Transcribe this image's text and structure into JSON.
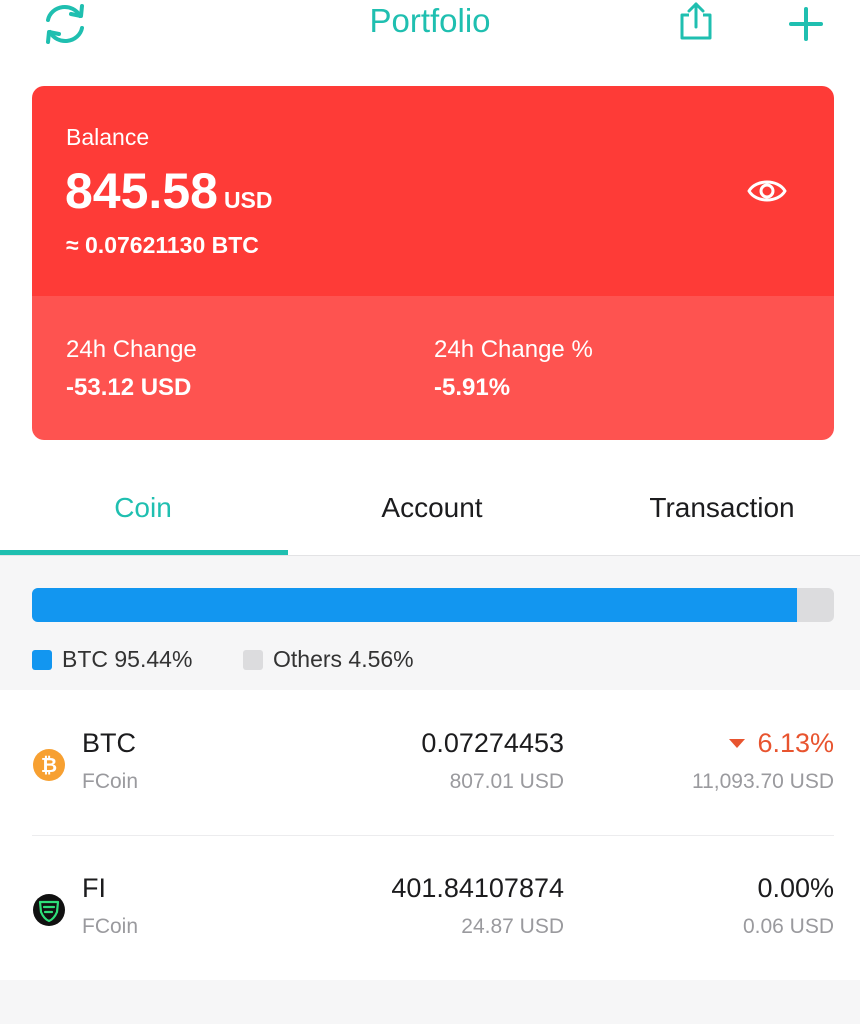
{
  "header": {
    "title": "Portfolio",
    "left_icon": "refresh-icon",
    "right_icons": [
      "share-icon",
      "plus-icon"
    ]
  },
  "balance": {
    "label": "Balance",
    "amount": "845.58",
    "unit": "USD",
    "btc_equivalent": "≈ 0.07621130 BTC",
    "visibility_icon": "eye-icon",
    "change_label": "24h Change",
    "change_value": "-53.12 USD",
    "change_pct_label": "24h Change %",
    "change_pct_value": "-5.91%"
  },
  "tabs": [
    {
      "label": "Coin",
      "active": true
    },
    {
      "label": "Account",
      "active": false
    },
    {
      "label": "Transaction",
      "active": false
    }
  ],
  "allocation": {
    "btc_fraction": 0.9544,
    "legend": [
      {
        "label": "BTC 95.44%",
        "color": "#1296f0"
      },
      {
        "label": "Others 4.56%",
        "color": "#dcdcde"
      }
    ]
  },
  "coins": [
    {
      "symbol": "BTC",
      "exchange": "FCoin",
      "quantity": "0.07274453",
      "value": "807.01 USD",
      "change": "6.13%",
      "change_direction": "down",
      "price": "11,093.70 USD",
      "icon": "bitcoin-icon"
    },
    {
      "symbol": "FI",
      "exchange": "FCoin",
      "quantity": "401.84107874",
      "value": "24.87 USD",
      "change": "0.00%",
      "change_direction": "flat",
      "price": "0.06 USD",
      "icon": "fi-token-icon"
    }
  ],
  "colors": {
    "accent": "#1fbfb0",
    "card_top": "#fe3b37",
    "card_bottom": "#fe5350",
    "negative": "#e8542f",
    "bar_fill": "#1296f0",
    "bar_track": "#dcdcde"
  }
}
